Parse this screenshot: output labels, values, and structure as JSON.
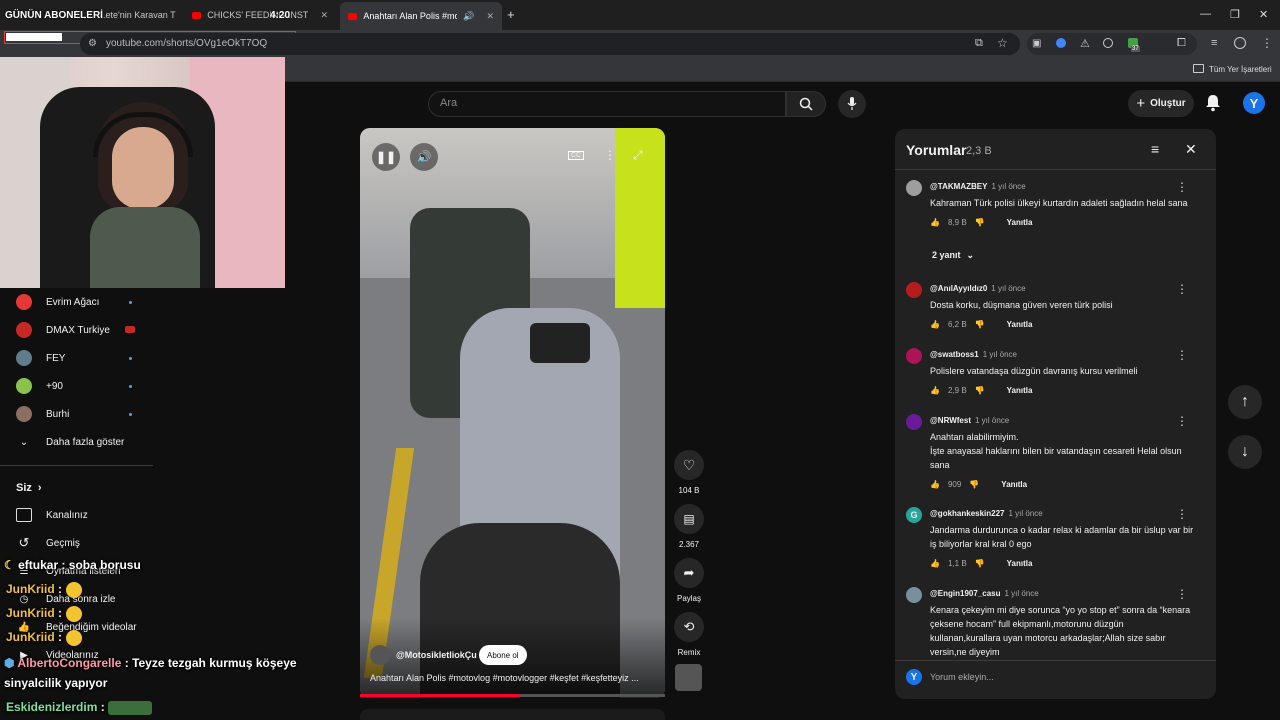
{
  "stream_overlay": {
    "subscribers_label": "GÜNÜN ABONELERİ",
    "timer": "4:20"
  },
  "tabs": [
    {
      "label": "...ete'nin Karavan T"
    },
    {
      "label": "CHICKS' FEEDING INSTINCT - Y"
    },
    {
      "label": "Anahtarı Alan Polis #motov"
    }
  ],
  "browser": {
    "url": "youtube.com/shorts/OVg1eOkT7OQ",
    "bookmarks_all": "Tüm Yer İşaretleri",
    "ext_badge": "37"
  },
  "youtube": {
    "search_placeholder": "Ara",
    "create_label": "Oluştur",
    "avatar_letter": "Y"
  },
  "sidebar": {
    "subscriptions": [
      {
        "name": "Evrim Ağacı",
        "color": "#e53935"
      },
      {
        "name": "DMAX Turkiye",
        "color": "#c62828"
      },
      {
        "name": "FEY",
        "color": "#607d8b"
      },
      {
        "name": "+90",
        "color": "#8bc34a"
      },
      {
        "name": "Burhi",
        "color": "#8d6e63"
      }
    ],
    "show_more": "Daha fazla göster",
    "you_label": "Siz",
    "you_items": [
      "Kanalınız",
      "Geçmiş",
      "Oynatma listeleri",
      "Daha sonra izle",
      "Beğendiğim videolar",
      "Videolarınız"
    ]
  },
  "video": {
    "channel": "@MotosikletliokÇu",
    "subscribe": "Abone ol",
    "title": "Anahtarı Alan Polis #motovlog #motovlogger #keşfet #keşfetteyiz ...",
    "like_count": "104 B",
    "comment_count": "2.367",
    "share_label": "Paylaş",
    "remix_label": "Remix",
    "progress": 0.52
  },
  "comments_panel": {
    "title": "Yorumlar",
    "count": "2,3 B",
    "reply_label": "Yanıtla",
    "add_placeholder": "Yorum ekleyin...",
    "items": [
      {
        "user": "@TAKMAZBEY",
        "time": "1 yıl önce",
        "text": "Kahraman Türk polisi ülkeyi kurtardın adaleti sağladın helal sana",
        "likes": "8,9 B",
        "replies": "2 yanıt",
        "color": "#9e9e9e"
      },
      {
        "user": "@AnılAyyıldız0",
        "time": "1 yıl önce",
        "text": "Dosta korku, düşmana güven veren türk polisi",
        "likes": "6,2 B",
        "color": "#b71c1c"
      },
      {
        "user": "@swatboss1",
        "time": "1 yıl önce",
        "text": "Polislere vatandaşa düzgün davranış kursu verilmeli",
        "likes": "2,9 B",
        "color": "#ad1457"
      },
      {
        "user": "@NRWfest",
        "time": "1 yıl önce",
        "text": "Anahtarı alabilirmiyim.\nİşte anayasal haklarını bilen bir vatandaşın cesareti Helal olsun sana",
        "likes": "909",
        "color": "#6a1b9a"
      },
      {
        "user": "@gokhankeskin227",
        "time": "1 yıl önce",
        "text": "Jandarma durdurunca o kadar relax ki adamlar da bir üslup var bir iş biliyorlar kral kral 0 ego",
        "likes": "1,1 B",
        "color": "#26a69a",
        "initial": "G"
      },
      {
        "user": "@Engin1907_casu",
        "time": "1 yıl önce",
        "text": "Kenara çekeyim mi diye sorunca “yo yo stop et” sonra da “kenara çeksene hocam” full ekipmanlı,motorunu düzgün kullanan,kurallara uyan motorcu arkadaşlar;Allah size sabır versin,ne diyeyim",
        "likes": "",
        "color": "#78909c"
      }
    ]
  },
  "chat": [
    {
      "user": "eftukar",
      "msg": "soba borusu",
      "color": "#ffffff"
    },
    {
      "user": "JunKriid",
      "msg": "",
      "color": "#f0c040"
    },
    {
      "user": "JunKriid",
      "msg": "",
      "color": "#f0c040"
    },
    {
      "user": "JunKriid",
      "msg": "",
      "color": "#f0c040"
    },
    {
      "user": "AlbertoCongarelle",
      "msg": "Teyze tezgah kurmuş köşeye",
      "color": "#ff9aa2"
    },
    {
      "user": "",
      "msg": "sinyalcilik yapıyor",
      "color": "#ffffff"
    },
    {
      "user": "Eskidenizlerdim",
      "msg": "",
      "color": "#7fe0a0"
    }
  ]
}
